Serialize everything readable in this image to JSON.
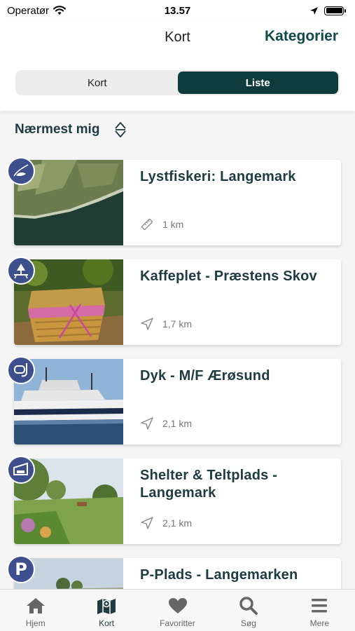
{
  "status": {
    "carrier": "Operatør",
    "time": "13.57"
  },
  "nav": {
    "title": "Kort",
    "right_button": "Kategorier"
  },
  "segments": [
    {
      "label": "Kort",
      "active": false
    },
    {
      "label": "Liste",
      "active": true
    }
  ],
  "sort": {
    "label": "Nærmest mig"
  },
  "items": [
    {
      "title": "Lystfiskeri: Langemark",
      "distance": "1 km",
      "icon": "fishing-icon",
      "distance_icon": "ruler-icon"
    },
    {
      "title": "Kaffeplet - Præstens Skov",
      "distance": "1,7 km",
      "icon": "picnic-icon",
      "distance_icon": "navigation-arrow-icon"
    },
    {
      "title": "Dyk - M/F Ærøsund",
      "distance": "2,1 km",
      "icon": "diving-mask-icon",
      "distance_icon": "navigation-arrow-icon"
    },
    {
      "title": "Shelter & Teltplads - Langemark",
      "distance": "2,1 km",
      "icon": "shelter-icon",
      "distance_icon": "navigation-arrow-icon"
    },
    {
      "title": "P-Plads - Langemarken",
      "distance": "",
      "icon": "parking-icon",
      "distance_icon": "navigation-arrow-icon"
    }
  ],
  "tabs": [
    {
      "label": "Hjem",
      "icon": "home-icon",
      "active": false
    },
    {
      "label": "Kort",
      "icon": "map-icon",
      "active": true
    },
    {
      "label": "Favoritter",
      "icon": "heart-icon",
      "active": false
    },
    {
      "label": "Søg",
      "icon": "search-icon",
      "active": false
    },
    {
      "label": "Mere",
      "icon": "menu-icon",
      "active": false
    }
  ],
  "colors": {
    "accent": "#0f3b3d",
    "badge": "#3e4f8e",
    "title_text": "#1d3b40"
  }
}
